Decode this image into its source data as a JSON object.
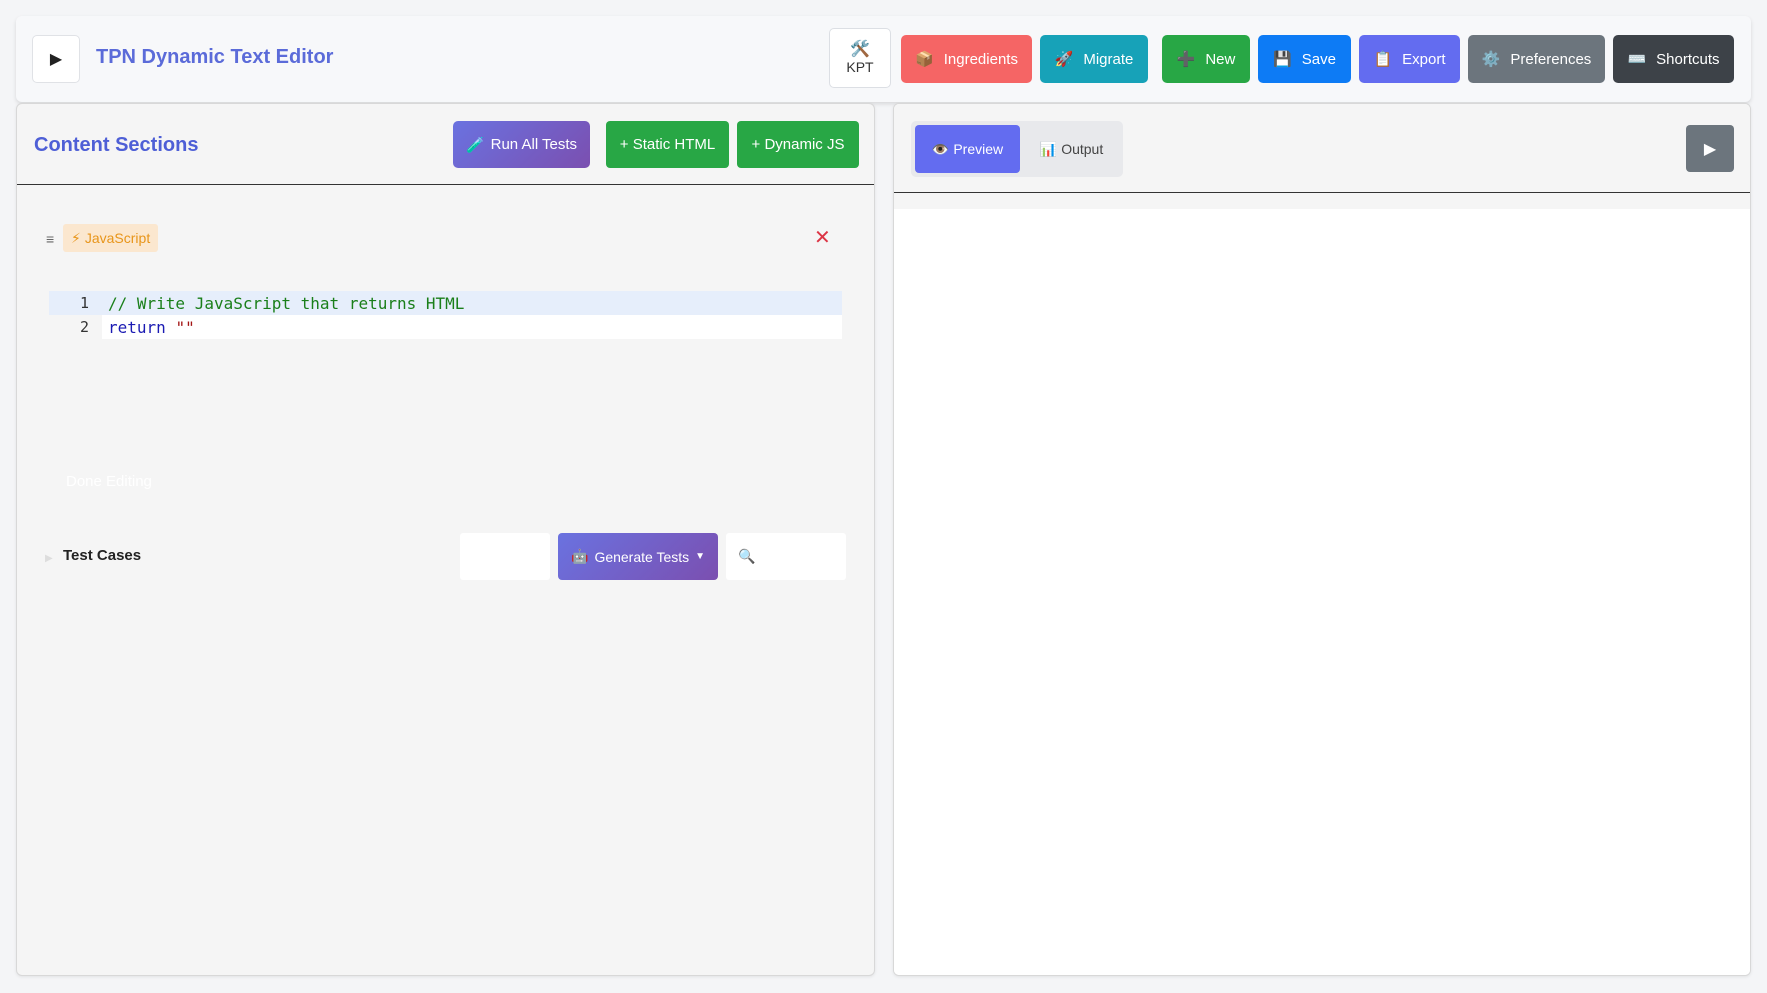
{
  "header": {
    "toggle_icon": "▶",
    "title": "TPN Dynamic Text Editor",
    "kpt": {
      "icon": "🛠️",
      "label": "KPT"
    },
    "buttons": [
      {
        "icon": "📦",
        "label": "Ingredients",
        "color": "#f56565"
      },
      {
        "icon": "🚀",
        "label": "Migrate",
        "color": "#17a2b8"
      },
      {
        "icon": "➕",
        "label": "New",
        "color": "#28a745"
      },
      {
        "icon": "💾",
        "label": "Save",
        "color": "#0d7bf5"
      },
      {
        "icon": "📋",
        "label": "Export",
        "color": "#636cf0"
      },
      {
        "icon": "⚙️",
        "label": "Preferences",
        "color": "#6c757d"
      },
      {
        "icon": "⌨️",
        "label": "Shortcuts",
        "color": "#3d4248"
      }
    ]
  },
  "content_panel": {
    "title": "Content Sections",
    "run_all_tests": {
      "icon": "🧪",
      "label": "Run All Tests"
    },
    "add_static_label": "+ Static HTML",
    "add_dynamic_label": "+ Dynamic JS",
    "section": {
      "drag_icon": "≡",
      "type_icon": "⚡",
      "type_label": "JavaScript",
      "delete_icon": "✕",
      "code_lines": [
        {
          "number": "1",
          "tokens": [
            {
              "type": "comment",
              "text": "// Write JavaScript that returns HTML"
            }
          ]
        },
        {
          "number": "2",
          "tokens": [
            {
              "type": "keyword",
              "text": "return"
            },
            {
              "type": "plain",
              "text": " "
            },
            {
              "type": "string",
              "text": "\"\""
            }
          ]
        }
      ],
      "done_editing_label": "Done Editing"
    },
    "test_cases": {
      "expand_icon": "▶",
      "title": "Test Cases",
      "generate": {
        "icon": "🤖",
        "label": "Generate Tests",
        "caret": "▼"
      },
      "search_icon": "🔍"
    }
  },
  "preview_panel": {
    "tabs": [
      {
        "icon": "👁️",
        "label": "Preview",
        "active": true
      },
      {
        "icon": "📊",
        "label": "Output",
        "active": false
      }
    ],
    "run_icon": "▶"
  }
}
